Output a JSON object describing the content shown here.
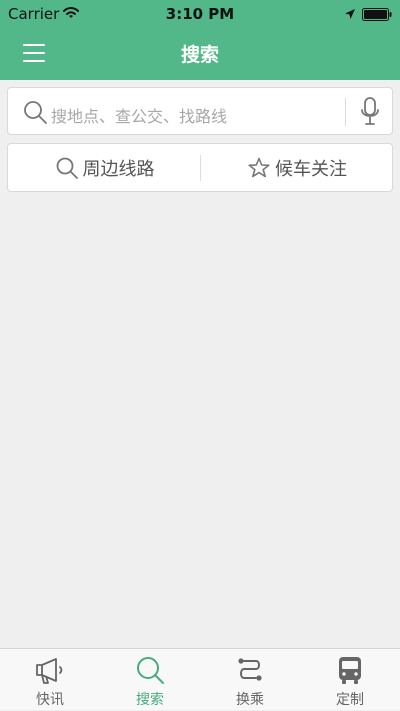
{
  "status_bar": {
    "carrier": "Carrier",
    "time": "3:10 PM"
  },
  "header": {
    "title": "搜索",
    "menu_icon": "menu-icon"
  },
  "search": {
    "placeholder": "搜地点、查公交、找路线",
    "icon": "search-icon",
    "mic_icon": "microphone-icon"
  },
  "quick_actions": [
    {
      "label": "周边线路",
      "icon": "search-icon"
    },
    {
      "label": "候车关注",
      "icon": "star-icon"
    }
  ],
  "tabs": [
    {
      "label": "快讯",
      "icon": "megaphone-icon",
      "active": false
    },
    {
      "label": "搜索",
      "icon": "search-icon",
      "active": true
    },
    {
      "label": "换乘",
      "icon": "transfer-icon",
      "active": false
    },
    {
      "label": "定制",
      "icon": "bus-icon",
      "active": false
    }
  ],
  "colors": {
    "accent": "#52b889",
    "active_tab": "#45ad7b",
    "background": "#efeff0"
  }
}
